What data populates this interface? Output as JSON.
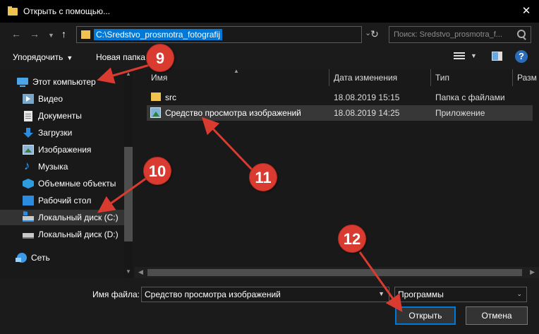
{
  "window": {
    "title": "Открыть с помощью...",
    "close_label": "✕"
  },
  "nav": {
    "address": "C:\\Sredstvo_prosmotra_fotografij",
    "search_placeholder": "Поиск: Sredstvo_prosmotra_f..."
  },
  "toolbar": {
    "organize_label": "Упорядочить",
    "new_folder_label": "Новая папка",
    "help_label": "?"
  },
  "sidebar": {
    "items": [
      {
        "label": "Этот компьютер",
        "icon": "computer-icon"
      },
      {
        "label": "Видео",
        "icon": "video-icon"
      },
      {
        "label": "Документы",
        "icon": "documents-icon"
      },
      {
        "label": "Загрузки",
        "icon": "downloads-icon"
      },
      {
        "label": "Изображения",
        "icon": "images-icon"
      },
      {
        "label": "Музыка",
        "icon": "music-icon"
      },
      {
        "label": "Объемные объекты",
        "icon": "3d-objects-icon"
      },
      {
        "label": "Рабочий стол",
        "icon": "desktop-icon"
      },
      {
        "label": "Локальный диск (C:)",
        "icon": "drive-c-icon"
      },
      {
        "label": "Локальный диск (D:)",
        "icon": "drive-d-icon"
      },
      {
        "label": "Сеть",
        "icon": "network-icon"
      }
    ]
  },
  "filelist": {
    "columns": [
      "Имя",
      "Дата изменения",
      "Тип",
      "Разм"
    ],
    "rows": [
      {
        "name": "src",
        "date": "18.08.2019 15:15",
        "type": "Папка с файлами",
        "icon": "folder-icon"
      },
      {
        "name": "Средство просмотра изображений",
        "date": "18.08.2019 14:25",
        "type": "Приложение",
        "icon": "application-icon"
      }
    ]
  },
  "bottom": {
    "filename_label": "Имя файла:",
    "filename_value": "Средство просмотра изображений",
    "filetype_value": "Программы",
    "open_label": "Открыть",
    "cancel_label": "Отмена"
  },
  "annotations": {
    "badges": [
      "9",
      "10",
      "11",
      "12"
    ],
    "color": "#d93b30"
  },
  "colors": {
    "accent": "#0078d7",
    "background": "#1b1b1b",
    "folder": "#f0c24f"
  }
}
